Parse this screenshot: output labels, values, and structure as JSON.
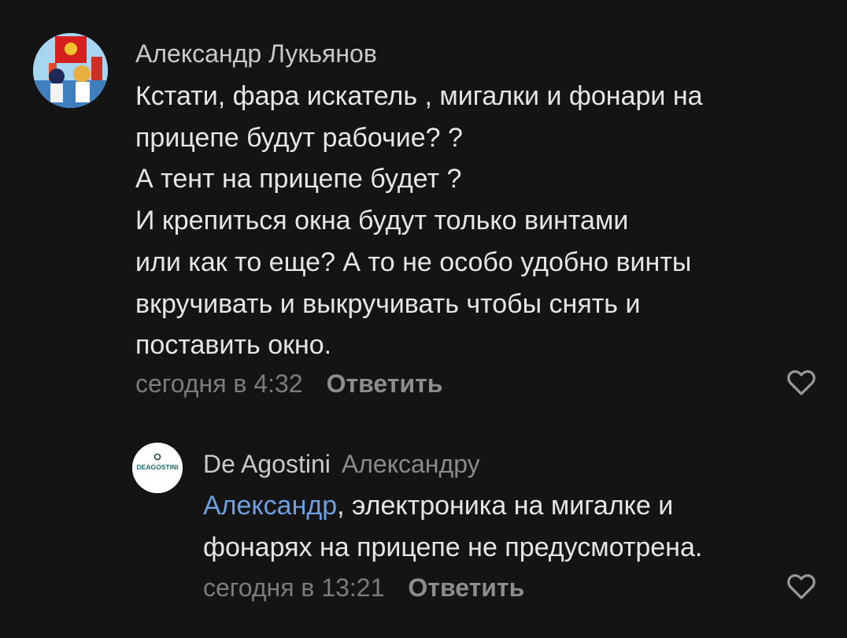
{
  "comments": [
    {
      "author": "Александр Лукьянов",
      "avatar": "user-avatar",
      "lines": [
        "Кстати, фара искатель , мигалки и фонари на",
        "прицепе будут рабочие? ?",
        "А тент на прицепе будет ?",
        "И крепиться окна будут только винтами",
        "или как то еще? А то не особо удобно винты",
        "вкручивать и выкручивать чтобы снять и",
        "поставить окно."
      ],
      "time": "сегодня в 4:32",
      "reply_label": "Ответить",
      "like_icon": "heart-outline-icon"
    },
    {
      "author": "De Agostini",
      "reply_to": "Александру",
      "avatar_logo_text": "DEAGOSTINI",
      "mention": "Александр",
      "line1_rest": ", электроника на мигалке и",
      "line2": "фонарях на прицепе не предусмотрена.",
      "time": "сегодня в 13:21",
      "reply_label": "Ответить",
      "like_icon": "heart-outline-icon"
    }
  ],
  "colors": {
    "background": "#141414",
    "text": "#e6e6e6",
    "author": "#c9c9c9",
    "secondary": "#7c7c7c",
    "mention": "#6f9fe0"
  }
}
